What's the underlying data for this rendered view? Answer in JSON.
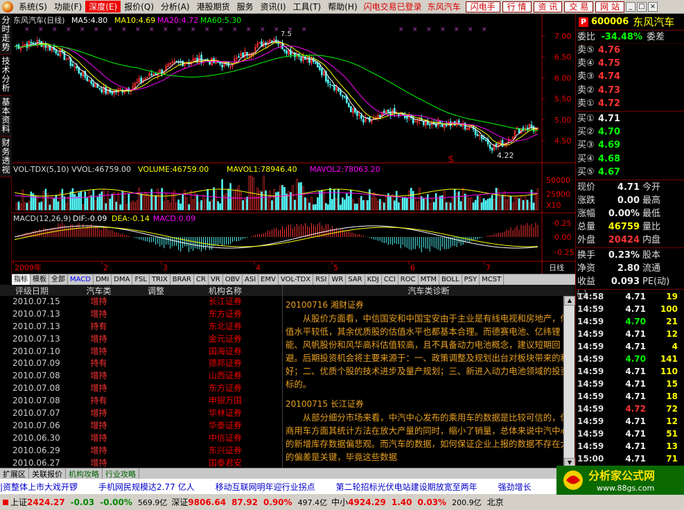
{
  "menu": {
    "items": [
      "系统(S)",
      "功能(F)",
      "深度(E)",
      "报价(Q)",
      "分析(A)",
      "港股期货",
      "服务",
      "资讯(I)",
      "工具(T)",
      "帮助(H)"
    ],
    "alert": "闪电交易已登录",
    "stock_link": "东风汽车",
    "buttons": [
      "闪电手",
      "行 情",
      "资 讯",
      "交 易",
      "网 站"
    ]
  },
  "left_tabs": [
    "分时走势",
    "技术分析",
    "基本资料",
    "财务透视"
  ],
  "chart": {
    "title": "东风汽车(日线)",
    "ma": [
      {
        "label": "MA5:4.80",
        "color": "#ffffff"
      },
      {
        "label": "MA10:4.69",
        "color": "#ffff00"
      },
      {
        "label": "MA20:4.72",
        "color": "#ff00ff"
      },
      {
        "label": "MA60:5.30",
        "color": "#00ff00"
      }
    ],
    "price_ticks": [
      "7.00",
      "6.50",
      "6.00",
      "5.50",
      "5.00",
      "4.50"
    ],
    "high_label": "7.5",
    "low_label": "4.22",
    "vol_title": "VOL-TDX(5,10) VVOL:46759.00",
    "vol_volume": "VOLUME:46759.00",
    "vol_mavol1": "MAVOL1:78946.40",
    "vol_mavol2": "MAVOL2:78063.20",
    "vol_ticks": [
      "50000",
      "25000",
      "X10"
    ],
    "macd_title": "MACD(12,26,9)",
    "macd_dif": "DIF:-0.09",
    "macd_dea": "DEA:-0.14",
    "macd_val": "MACD:0.09",
    "macd_ticks": [
      "0.25",
      "0.00",
      "-0.25"
    ],
    "month_labels": [
      "2009年",
      "2",
      "3",
      "4",
      "5",
      "6",
      "7"
    ],
    "period": "日线",
    "s_marker": "S"
  },
  "indicator_tabs": [
    "指标",
    "模板",
    "全部",
    "MACD",
    "DMI",
    "DMA",
    "FSL",
    "TRIX",
    "BRAR",
    "CR",
    "VR",
    "OBV",
    "ASI",
    "EMV",
    "VOL-TDX",
    "RSI",
    "WR",
    "SAR",
    "KDJ",
    "CCI",
    "ROC",
    "MTM",
    "BOLL",
    "PSY",
    "MCST"
  ],
  "ratings": {
    "headers": [
      "评级日期",
      "汽车类",
      "调整",
      "机构名称"
    ],
    "rows": [
      {
        "date": "2010.07.15",
        "rating": "增持",
        "org": "长江证券"
      },
      {
        "date": "2010.07.13",
        "rating": "增持",
        "org": "东方证券"
      },
      {
        "date": "2010.07.13",
        "rating": "持有",
        "org": "东北证券"
      },
      {
        "date": "2010.07.13",
        "rating": "增持",
        "org": "金元证券"
      },
      {
        "date": "2010.07.10",
        "rating": "增持",
        "org": "国海证券"
      },
      {
        "date": "2010.07.09",
        "rating": "持有",
        "org": "德邦证券"
      },
      {
        "date": "2010.07.08",
        "rating": "增持",
        "org": "山西证券"
      },
      {
        "date": "2010.07.08",
        "rating": "增持",
        "org": "东方证券"
      },
      {
        "date": "2010.07.08",
        "rating": "持有",
        "org": "申银万国"
      },
      {
        "date": "2010.07.07",
        "rating": "增持",
        "org": "华林证券"
      },
      {
        "date": "2010.07.06",
        "rating": "增持",
        "org": "华泰证券"
      },
      {
        "date": "2010.06.30",
        "rating": "增持",
        "org": "中信证券"
      },
      {
        "date": "2010.06.29",
        "rating": "增持",
        "org": "东兴证券"
      },
      {
        "date": "2010.06.27",
        "rating": "增持",
        "org": "国泰君安"
      }
    ]
  },
  "diagnosis": {
    "header": "汽车类诊断",
    "title1": "20100716 湘财证券",
    "body1": "从股价方面看，中信国安和中国宝安由于主业是有线电视和房地产，估值水平较低，其余优质股的估值水平也都基本合理。而德赛电池、亿纬锂能、风帆股份和风华高科估值较高，且不具备动力电池概念，建议短期回避。后期投资机会将主要来源于：一、政策调整及规划出台对板块带来的利好；二、优质个股的技术进步及量产规划；三、新进入动力电池领域的投资标的。",
    "title2": "20100715 长江证券",
    "body2": "从部分细分市场来看，中汽中心发布的乘用车的数据是比较可信的，但商用车方面其统计方法在放大产量的同时，缩小了销量，总体来说中汽中心的新增库存数据偏悲观。而汽车的数据，如何保证企业上报的数据不存在大的偏差是关键，毕竟这些数据"
  },
  "bottom_tabs": [
    "扩展区",
    "关联报价",
    "机构攻略",
    "行业攻略"
  ],
  "ticker": [
    "|资整体上市大戏开锣",
    "手机网民规模达2.77 亿人",
    "移动互联网明年迎行业拐点",
    "第二轮招标光伏电站建设期放宽至两年",
    "强劲增长"
  ],
  "status": {
    "sh_label": "上证",
    "sh_val": "2424.27",
    "sh_chg": "-0.03",
    "sh_pct": "-0.00%",
    "sh_amt": "569.9亿",
    "sz_label": "深证",
    "sz_val": "9806.64",
    "sz_chg": "87.92",
    "sz_pct": "0.90%",
    "sz_amt": "497.4亿",
    "zx_label": "中小",
    "zx_val": "4924.29",
    "zx_chg": "1.40",
    "zx_pct": "0.03%",
    "zx_amt": "200.9亿",
    "tail": "北京"
  },
  "quote": {
    "badge": "P",
    "code": "600006",
    "name": "东风汽车",
    "weibi_label": "委比",
    "weibi": "-34.48%",
    "weicha_label": "委差",
    "asks": [
      {
        "l": "卖⑤",
        "p": "4.76"
      },
      {
        "l": "卖④",
        "p": "4.75"
      },
      {
        "l": "卖③",
        "p": "4.74"
      },
      {
        "l": "卖②",
        "p": "4.73"
      },
      {
        "l": "卖①",
        "p": "4.72"
      }
    ],
    "bids": [
      {
        "l": "买①",
        "p": "4.71"
      },
      {
        "l": "买②",
        "p": "4.70"
      },
      {
        "l": "买③",
        "p": "4.69"
      },
      {
        "l": "买④",
        "p": "4.68"
      },
      {
        "l": "买⑤",
        "p": "4.67"
      }
    ],
    "stats": [
      {
        "a": "现价",
        "b": "4.71",
        "bc": "wht",
        "c": "今开"
      },
      {
        "a": "涨跌",
        "b": "0.00",
        "bc": "wht",
        "c": "最高"
      },
      {
        "a": "涨幅",
        "b": "0.00%",
        "bc": "wht",
        "c": "最低"
      },
      {
        "a": "总量",
        "b": "46759",
        "bc": "yel",
        "c": "量比"
      },
      {
        "a": "外盘",
        "b": "20424",
        "bc": "red",
        "c": "内盘"
      }
    ],
    "stats2": [
      {
        "a": "换手",
        "b": "0.23%",
        "bc": "wht",
        "c": "股本"
      },
      {
        "a": "净资",
        "b": "2.80",
        "bc": "wht",
        "c": "流通"
      },
      {
        "a": "收益㈠",
        "b": "0.093",
        "bc": "wht",
        "c": "PE(动)"
      }
    ],
    "ticks": [
      {
        "t": "14:58",
        "p": "4.71",
        "pc": "wht",
        "v": "19"
      },
      {
        "t": "14:59",
        "p": "4.71",
        "pc": "wht",
        "v": "100"
      },
      {
        "t": "14:59",
        "p": "4.70",
        "pc": "grn",
        "v": "21"
      },
      {
        "t": "14:59",
        "p": "4.71",
        "pc": "wht",
        "v": "12"
      },
      {
        "t": "14:59",
        "p": "4.71",
        "pc": "wht",
        "v": "4"
      },
      {
        "t": "14:59",
        "p": "4.70",
        "pc": "grn",
        "v": "141"
      },
      {
        "t": "14:59",
        "p": "4.71",
        "pc": "wht",
        "v": "110"
      },
      {
        "t": "14:59",
        "p": "4.71",
        "pc": "wht",
        "v": "15"
      },
      {
        "t": "14:59",
        "p": "4.71",
        "pc": "wht",
        "v": "18"
      },
      {
        "t": "14:59",
        "p": "4.72",
        "pc": "red",
        "v": "72"
      },
      {
        "t": "14:59",
        "p": "4.71",
        "pc": "wht",
        "v": "12"
      },
      {
        "t": "14:59",
        "p": "4.71",
        "pc": "wht",
        "v": "51"
      },
      {
        "t": "14:59",
        "p": "4.71",
        "pc": "wht",
        "v": "13"
      },
      {
        "t": "15:00",
        "p": "4.71",
        "pc": "wht",
        "v": "71"
      }
    ]
  },
  "watermark": {
    "text": "分析家公式网",
    "url": "www.88gs.com"
  }
}
